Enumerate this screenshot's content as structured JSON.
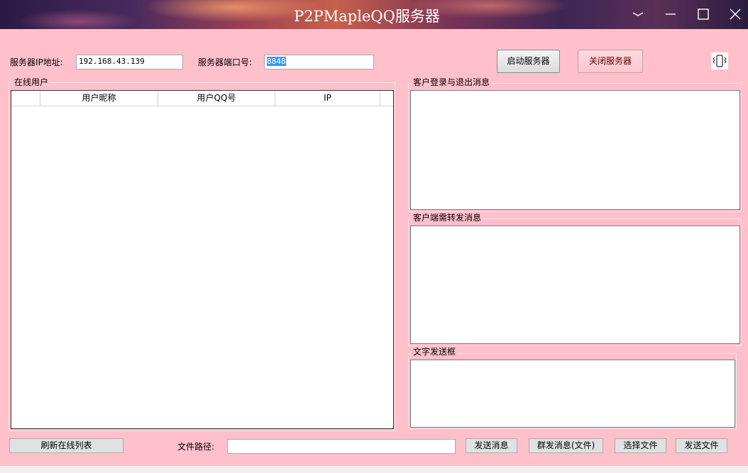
{
  "window": {
    "title": "P2PMapleQQ服务器",
    "controls": {
      "extra_icon": "chevron-icon",
      "minimize": "—",
      "maximize": "☐",
      "close": "✕"
    }
  },
  "server": {
    "ip_label": "服务器IP地址:",
    "ip_value": "192.168.43.139",
    "port_label": "服务器端口号:",
    "port_value": "8848",
    "start_button": "启动服务器",
    "stop_button": "关闭服务器",
    "vibrate_icon": "vibrate-icon"
  },
  "online_users": {
    "title": "在线用户",
    "columns": [
      "",
      "用户昵称",
      "用户QQ号",
      "IP"
    ],
    "rows": []
  },
  "login_logout": {
    "title": "客户登录与退出消息",
    "text": ""
  },
  "forward": {
    "title": "客户端需转发消息",
    "text": ""
  },
  "text_send": {
    "title": "文字发送框",
    "text": ""
  },
  "footer": {
    "refresh_button": "刷新在线列表",
    "file_path_label": "文件路径:",
    "file_path_value": "",
    "send_message_button": "发送消息",
    "broadcast_button": "群发消息(文件)",
    "choose_file_button": "选择文件",
    "send_file_button": "发送文件"
  }
}
